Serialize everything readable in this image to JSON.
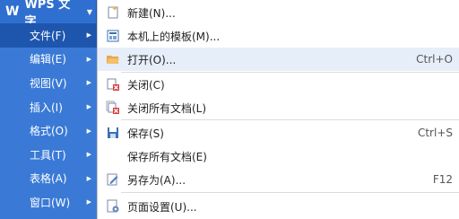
{
  "app": {
    "logo": "W",
    "title": "WPS 文字"
  },
  "left_menu": {
    "items": [
      {
        "label": "文件(F)",
        "selected": true
      },
      {
        "label": "编辑(E)"
      },
      {
        "label": "视图(V)"
      },
      {
        "label": "插入(I)"
      },
      {
        "label": "格式(O)"
      },
      {
        "label": "工具(T)"
      },
      {
        "label": "表格(A)"
      },
      {
        "label": "窗口(W)"
      }
    ]
  },
  "dropdown": {
    "items": [
      {
        "label": "新建(N)...",
        "icon": "new-document-icon"
      },
      {
        "label": "本机上的模板(M)...",
        "icon": "template-icon"
      },
      {
        "label": "打开(O)...",
        "shortcut": "Ctrl+O",
        "icon": "open-folder-icon",
        "highlight": true
      },
      {
        "label": "关闭(C)",
        "icon": "close-document-icon"
      },
      {
        "label": "关闭所有文档(L)",
        "icon": "close-all-icon"
      },
      {
        "label": "保存(S)",
        "shortcut": "Ctrl+S",
        "icon": "save-icon"
      },
      {
        "label": "保存所有文档(E)",
        "icon": ""
      },
      {
        "label": "另存为(A)...",
        "shortcut": "F12",
        "icon": "save-as-icon"
      },
      {
        "label": "页面设置(U)...",
        "icon": "page-setup-icon"
      }
    ]
  },
  "colors": {
    "menu_blue": "#3a7ad6",
    "selected_blue": "#1e56ad",
    "highlight": "#e6eef9"
  }
}
